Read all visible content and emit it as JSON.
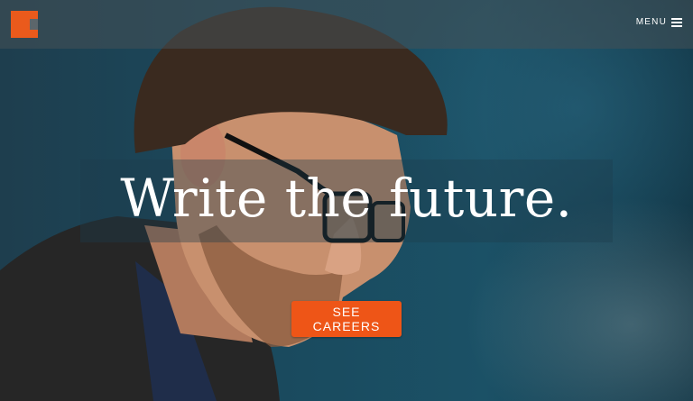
{
  "header": {
    "menu_label": "MENU",
    "brand_color": "#ea5a1c"
  },
  "hero": {
    "headline": "Write the future.",
    "cta_label": "SEE CAREERS",
    "cta_color": "#ee5517",
    "photo_icon": "person-with-glasses-photo"
  }
}
